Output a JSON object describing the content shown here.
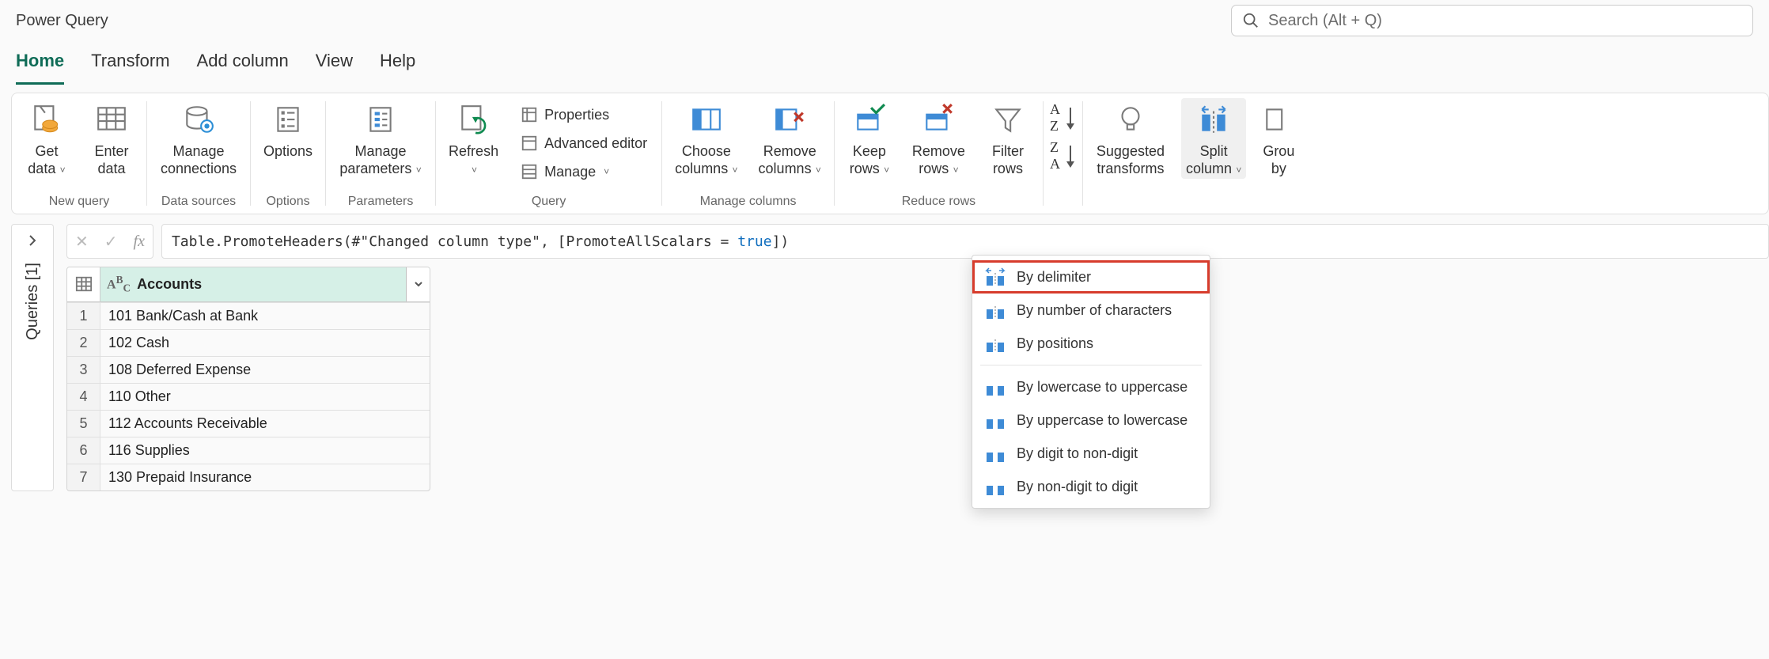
{
  "app_title": "Power Query",
  "search": {
    "placeholder": "Search (Alt + Q)"
  },
  "tabs": [
    "Home",
    "Transform",
    "Add column",
    "View",
    "Help"
  ],
  "active_tab": "Home",
  "ribbon": {
    "get_data": "Get data",
    "enter_data": "Enter data",
    "new_query": "New query",
    "manage_connections": "Manage connections",
    "data_sources": "Data sources",
    "options": "Options",
    "options_group": "Options",
    "manage_parameters": "Manage parameters",
    "parameters": "Parameters",
    "refresh": "Refresh",
    "properties": "Properties",
    "advanced_editor": "Advanced editor",
    "manage": "Manage",
    "query_group": "Query",
    "choose_columns": "Choose columns",
    "remove_columns": "Remove columns",
    "manage_columns": "Manage columns",
    "keep_rows": "Keep rows",
    "remove_rows": "Remove rows",
    "filter_rows": "Filter rows",
    "reduce_rows": "Reduce rows",
    "sort_group": "Sort",
    "suggested_transforms": "Suggested transforms",
    "split_column": "Split column",
    "group_by": "Group by"
  },
  "queries_panel_label": "Queries [1]",
  "formula": {
    "prefix": "Table.PromoteHeaders(#\"Changed column type\", [PromoteAllScalars = ",
    "keyword": "true",
    "suffix": "])"
  },
  "grid": {
    "column_header": "Accounts",
    "rows": [
      "101 Bank/Cash at Bank",
      "102 Cash",
      "108 Deferred Expense",
      "110 Other",
      "112 Accounts Receivable",
      "116 Supplies",
      "130 Prepaid Insurance"
    ]
  },
  "split_menu": {
    "by_delimiter": "By delimiter",
    "by_num_chars": "By number of characters",
    "by_positions": "By positions",
    "lower_upper": "By lowercase to uppercase",
    "upper_lower": "By uppercase to lowercase",
    "digit_nondigit": "By digit to non-digit",
    "nondigit_digit": "By non-digit to digit"
  }
}
